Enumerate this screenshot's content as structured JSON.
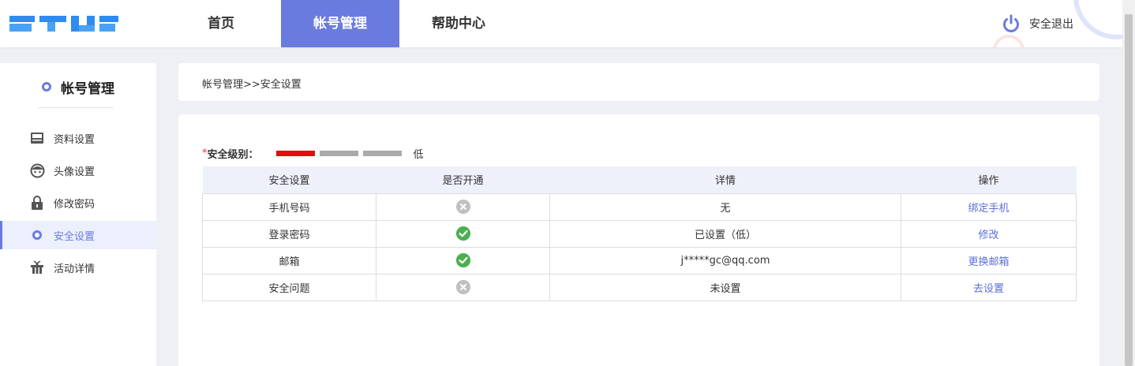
{
  "header": {
    "nav": [
      "首页",
      "帐号管理",
      "帮助中心"
    ],
    "active_nav": "帐号管理",
    "logout": "安全退出"
  },
  "sidebar": {
    "title": "帐号管理",
    "items": [
      {
        "label": "资料设置",
        "icon": "id-card-icon"
      },
      {
        "label": "头像设置",
        "icon": "face-icon"
      },
      {
        "label": "修改密码",
        "icon": "lock-icon"
      },
      {
        "label": "安全设置",
        "icon": "shield-dot-icon",
        "active": true
      },
      {
        "label": "活动详情",
        "icon": "gift-icon"
      }
    ]
  },
  "breadcrumb": "帐号管理>>安全设置",
  "security": {
    "required_mark": "*",
    "level_label": "安全级别：",
    "level_text": "低",
    "level_filled": 1,
    "level_total": 3,
    "colors": {
      "filled": "#e40c0c",
      "empty": "#aaaaaa",
      "accent": "#6a7be0",
      "link": "#5b6fd8",
      "ok": "#4caf50",
      "no": "#c0c0c0"
    }
  },
  "table": {
    "headers": [
      "安全设置",
      "是否开通",
      "详情",
      "操作"
    ],
    "rows": [
      {
        "item": "手机号码",
        "enabled": false,
        "detail": "无",
        "action": "绑定手机"
      },
      {
        "item": "登录密码",
        "enabled": true,
        "detail": "已设置（低）",
        "action": "修改"
      },
      {
        "item": "邮箱",
        "enabled": true,
        "detail": "j*****gc@qq.com",
        "action": "更换邮箱"
      },
      {
        "item": "安全问题",
        "enabled": false,
        "detail": "未设置",
        "action": "去设置"
      }
    ]
  }
}
